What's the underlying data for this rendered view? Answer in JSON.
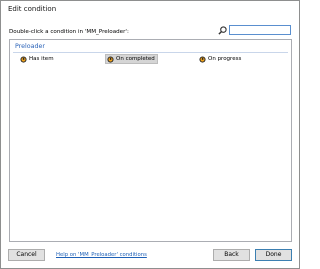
{
  "window": {
    "title": "Edit condition"
  },
  "prompt": "Double-click a condition in 'MM_Preloader':",
  "search": {
    "value": "",
    "placeholder": "",
    "icon": "magnifier-icon"
  },
  "group": {
    "name": "Preloader",
    "items": [
      {
        "label": "Has item",
        "icon": "condition-icon",
        "selected": false
      },
      {
        "label": "On completed",
        "icon": "condition-icon",
        "selected": true
      },
      {
        "label": "On progress",
        "icon": "condition-icon",
        "selected": false
      }
    ]
  },
  "footer": {
    "cancel_label": "Cancel",
    "help_link": "Help on 'MM_Preloader' conditions",
    "back_label": "Back",
    "done_label": "Done"
  },
  "colors": {
    "link": "#1c5fb6",
    "group_header": "#2b63b8",
    "focus_border": "#5a8fcf"
  }
}
